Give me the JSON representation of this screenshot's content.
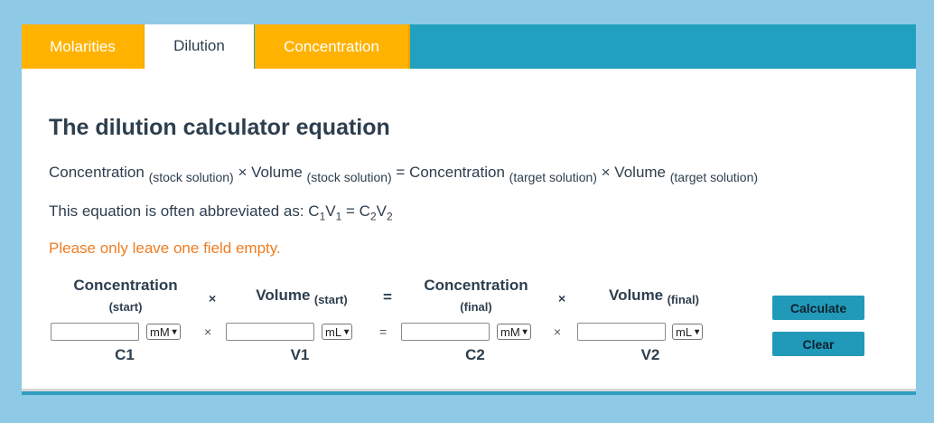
{
  "tabs": [
    {
      "label": "Molarities",
      "active": false
    },
    {
      "label": "Dilution",
      "active": true
    },
    {
      "label": "Concentration",
      "active": false
    }
  ],
  "heading": "The dilution calculator equation",
  "equation": {
    "t1": "Concentration ",
    "s1": "(stock solution)",
    "t2": " × Volume ",
    "s2": "(stock solution)",
    "t3": " = Concentration ",
    "s3": "(target solution)",
    "t4": " × Volume ",
    "s4": "(target solution)"
  },
  "abbreviation": {
    "prefix": "This equation is often abbreviated as: ",
    "c1": "C",
    "c1sub": "1",
    "v1": "V",
    "v1sub": "1",
    "eq": " = ",
    "c2": "C",
    "c2sub": "2",
    "v2": "V",
    "v2sub": "2"
  },
  "warning": "Please only leave one field empty.",
  "calculator": {
    "columns": [
      {
        "title": "Concentration",
        "sub": "(start)",
        "unit": "mM",
        "var": "C1",
        "value": ""
      },
      {
        "title": "Volume",
        "sub": "(start)",
        "unit": "mL",
        "var": "V1",
        "value": ""
      },
      {
        "title": "Concentration",
        "sub": "(final)",
        "unit": "mM",
        "var": "C2",
        "value": ""
      },
      {
        "title": "Volume",
        "sub": "(final)",
        "unit": "mL",
        "var": "V2",
        "value": ""
      }
    ],
    "times": "×",
    "equals": "="
  },
  "buttons": {
    "calculate": "Calculate",
    "clear": "Clear"
  },
  "colors": {
    "tab": "#ffb300",
    "tabbar": "#22a0bf",
    "warning": "#ef7d22",
    "button": "#2199b8"
  }
}
